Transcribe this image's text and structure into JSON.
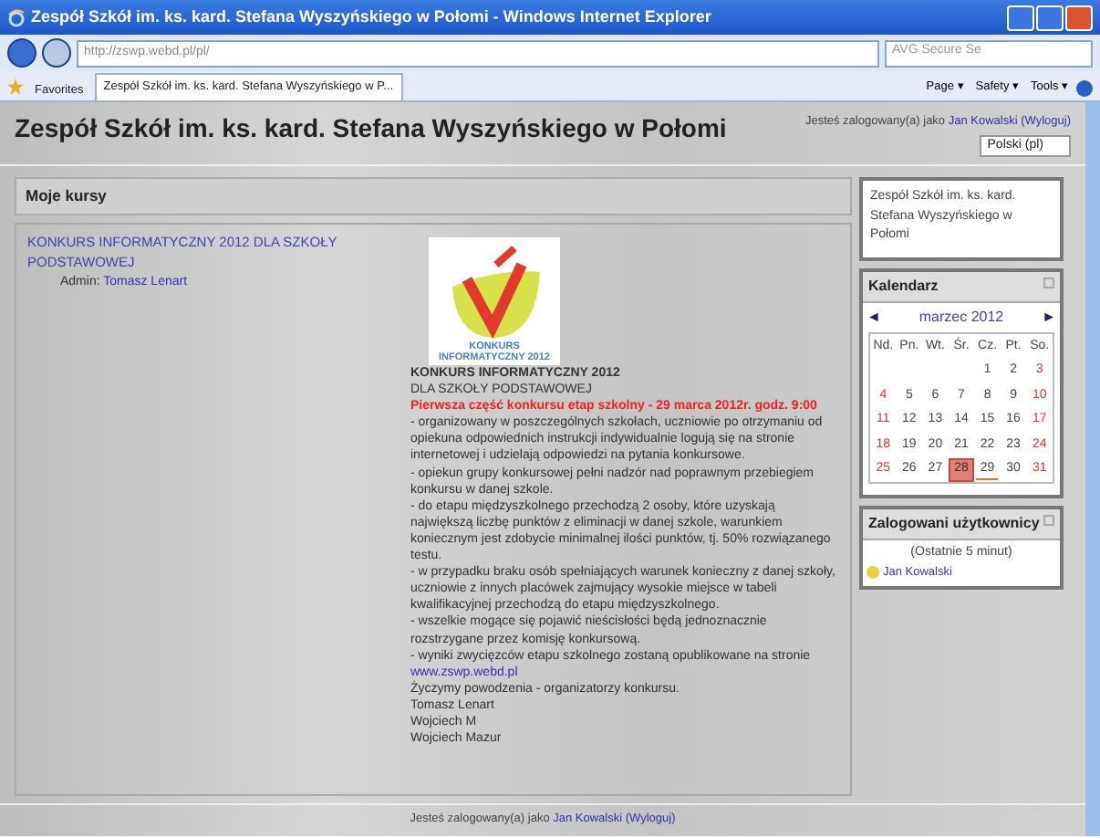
{
  "window": {
    "title": "Zespół Szkół im. ks. kard. Stefana Wyszyńskiego w Połomi - Windows Internet Explorer"
  },
  "address_bar": {
    "url": "http://zswp.webd.pl/pl/",
    "search_placeholder": "AVG Secure Se"
  },
  "favorites": {
    "label": "Favorites"
  },
  "tabs": [
    {
      "label": "Zespół Szkół im. ks. kard. Stefana Wyszyńskiego w P...",
      "selected": true
    }
  ],
  "command_bar": [
    "Page ▾",
    "Safety ▾",
    "Tools ▾"
  ],
  "header": {
    "title": "Zespół Szkół im. ks. kard. Stefana Wyszyńskiego w Połomi",
    "login_prefix": "Jesteś zalogowany(a) jako",
    "user": "Jan Kowalski",
    "logout": "(Wyloguj)",
    "language": "Polski (pl)"
  },
  "courses": {
    "heading": "Moje kursy",
    "course_title": "KONKURS INFORMATYCZNY 2012 DLA SZKOŁY PODSTAWOWEJ",
    "admin_label": "Admin:",
    "admin_name": "Tomasz Lenart"
  },
  "logo": {
    "line_1": "KONKURS",
    "line_2": "INFORMATYCZNY 2012"
  },
  "summary": [
    {
      "kind": "bold",
      "text": "KONKURS INFORMATYCZNY 2012"
    },
    {
      "kind": "plain",
      "text": "DLA SZKOŁY PODSTAWOWEJ"
    },
    {
      "kind": "alert",
      "text": "Pierwsza część konkursu etap szkolny - 29 marca 2012r. godz. 9:00"
    },
    {
      "kind": "plain",
      "text": "- organizowany w poszczególnych szkołach, uczniowie po otrzymaniu od opiekuna odpowiednich instrukcji indywidualnie logują się na stronie internetowej i udzielają odpowiedzi na pytania konkursowe."
    },
    {
      "kind": "plain",
      "text": "- opiekun grupy konkursowej pełni nadzór nad poprawnym przebiegiem konkursu w danej szkole."
    },
    {
      "kind": "plain",
      "text": "- do etapu międzyszkolnego przechodzą 2 osoby, które uzyskają największą liczbę punktów z eliminacji w danej szkole, warunkiem koniecznym jest zdobycie minimalnej ilości punktów, tj. 50% rozwiązanego testu."
    },
    {
      "kind": "plain",
      "text": "- w przypadku braku osób spełniających warunek konieczny z danej szkoły, uczniowie z innych placówek zajmujący wysokie miejsce w tabeli kwalifikacyjnej przechodzą do etapu międzyszkolnego."
    },
    {
      "kind": "plain",
      "text": "- wszelkie mogące się pojawić nieścisłości będą jednoznacznie rozstrzygane przez komisję konkursową."
    },
    {
      "kind": "plain",
      "text": "- wyniki zwycięzców etapu szkolnego zostaną opublikowane na stronie"
    },
    {
      "kind": "link",
      "text": "www.zswp.webd.pl"
    },
    {
      "kind": "plain",
      "text": "Życzymy powodzenia - organizatorzy konkursu."
    },
    {
      "kind": "plain",
      "text": "Tomasz Lenart"
    },
    {
      "kind": "plain",
      "text": "Wojciech M"
    },
    {
      "kind": "plain",
      "text": "Wojciech Mazur"
    }
  ],
  "school_block": {
    "text": "Zespół Szkół im. ks. kard. Stefana Wyszyńskiego w Połomi"
  },
  "calendar": {
    "title": "Kalendarz",
    "prev": "◄",
    "month": "marzec 2012",
    "next": "►",
    "weekdays": [
      "Nd.",
      "Pn.",
      "Wt.",
      "Śr.",
      "Cz.",
      "Pt.",
      "So."
    ],
    "weeks": [
      [
        {
          "day": "1",
          "today": false,
          "event": false
        },
        {
          "day": "2",
          "today": false,
          "event": false
        },
        {
          "day": "3",
          "today": false,
          "event": false
        }
      ],
      [
        {
          "day": "4",
          "today": false,
          "event": false
        },
        {
          "day": "5",
          "today": false,
          "event": false
        },
        {
          "day": "6",
          "today": false,
          "event": false
        },
        {
          "day": "7",
          "today": false,
          "event": false
        },
        {
          "day": "8",
          "today": false,
          "event": false
        },
        {
          "day": "9",
          "today": false,
          "event": false
        },
        {
          "day": "10",
          "today": false,
          "event": false
        }
      ],
      [
        {
          "day": "11",
          "today": false,
          "event": false
        },
        {
          "day": "12",
          "today": false,
          "event": false
        },
        {
          "day": "13",
          "today": false,
          "event": false
        },
        {
          "day": "14",
          "today": false,
          "event": false
        },
        {
          "day": "15",
          "today": false,
          "event": false
        },
        {
          "day": "16",
          "today": false,
          "event": false
        },
        {
          "day": "17",
          "today": false,
          "event": false
        }
      ],
      [
        {
          "day": "18",
          "today": false,
          "event": false
        },
        {
          "day": "19",
          "today": false,
          "event": false
        },
        {
          "day": "20",
          "today": false,
          "event": false
        },
        {
          "day": "21",
          "today": false,
          "event": false
        },
        {
          "day": "22",
          "today": false,
          "event": false
        },
        {
          "day": "23",
          "today": false,
          "event": false
        },
        {
          "day": "24",
          "today": false,
          "event": false
        }
      ],
      [
        {
          "day": "25",
          "today": false,
          "event": false
        },
        {
          "day": "26",
          "today": false,
          "event": false
        },
        {
          "day": "27",
          "today": false,
          "event": false
        },
        {
          "day": "28",
          "today": true,
          "event": false
        },
        {
          "day": "29",
          "today": false,
          "event": true
        },
        {
          "day": "30",
          "today": false,
          "event": false
        },
        {
          "day": "31",
          "today": false,
          "event": false
        }
      ]
    ]
  },
  "online_users": {
    "title": "Zalogowani użytkownicy",
    "period": "(Ostatnie 5 minut)",
    "users": [
      "Jan Kowalski"
    ]
  },
  "footer": {
    "login_prefix": "Jesteś zalogowany(a) jako",
    "user": "Jan Kowalski",
    "logout": "(Wyloguj)"
  }
}
